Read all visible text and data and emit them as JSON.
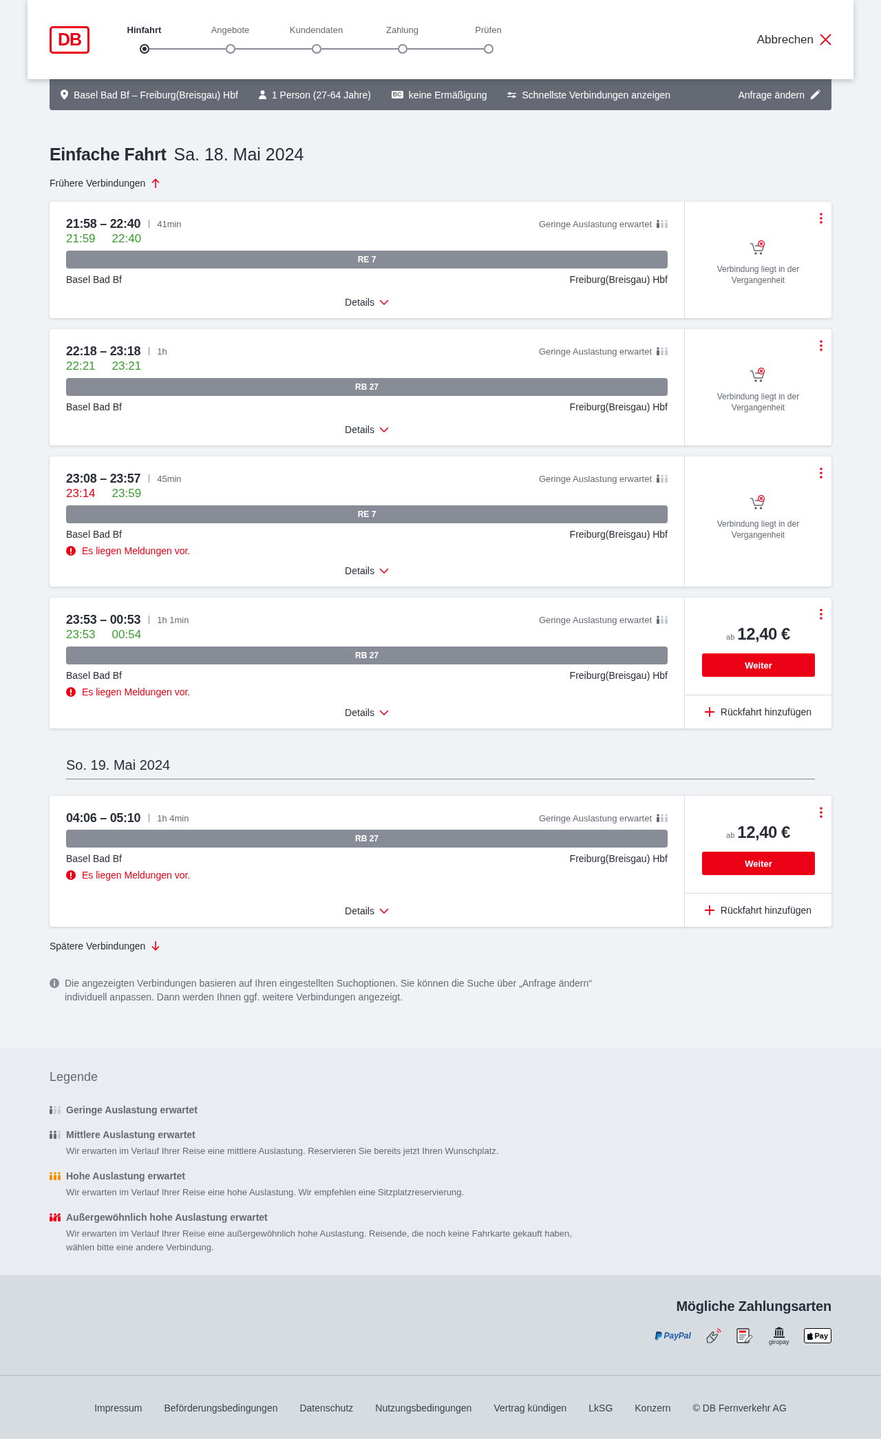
{
  "header": {
    "logo": "DB",
    "steps": [
      {
        "label": "Hinfahrt",
        "selected": true
      },
      {
        "label": "Angebote",
        "selected": false
      },
      {
        "label": "Kundendaten",
        "selected": false
      },
      {
        "label": "Zahlung",
        "selected": false
      },
      {
        "label": "Prüfen",
        "selected": false
      }
    ],
    "cancel": "Abbrechen"
  },
  "search_summary": {
    "route": "Basel Bad Bf – Freiburg(Breisgau) Hbf",
    "travelers": "1 Person (27-64 Jahre)",
    "discount_badge": "BC",
    "discount": "keine Ermäßigung",
    "option": "Schnellste Verbindungen anzeigen",
    "edit": "Anfrage ändern"
  },
  "results": {
    "title": "Einfache Fahrt",
    "date": "Sa. 18. Mai 2024",
    "earlier": "Frühere Verbindungen",
    "days": [
      {
        "connections": [
          {
            "times": "21:58 – 22:40",
            "duration": "41min",
            "realtime": [
              {
                "time": "21:59",
                "delayed": false
              },
              {
                "time": "22:40",
                "delayed": false
              }
            ],
            "occupancy": {
              "kind": "low",
              "label": "Geringe Auslastung erwartet"
            },
            "train": "RE 7",
            "from": "Basel Bad Bf",
            "to": "Freiburg(Breisgau) Hbf",
            "details": "Details",
            "offer": {
              "kind": "past",
              "text": "Verbindung liegt in der Vergangenheit"
            }
          },
          {
            "times": "22:18 – 23:18",
            "duration": "1h",
            "realtime": [
              {
                "time": "22:21",
                "delayed": false
              },
              {
                "time": "23:21",
                "delayed": false
              }
            ],
            "occupancy": {
              "kind": "low",
              "label": "Geringe Auslastung erwartet"
            },
            "train": "RB 27",
            "from": "Basel Bad Bf",
            "to": "Freiburg(Breisgau) Hbf",
            "details": "Details",
            "offer": {
              "kind": "past",
              "text": "Verbindung liegt in der Vergangenheit"
            }
          },
          {
            "times": "23:08 – 23:57",
            "duration": "45min",
            "realtime": [
              {
                "time": "23:14",
                "delayed": true
              },
              {
                "time": "23:59",
                "delayed": false
              }
            ],
            "occupancy": {
              "kind": "low",
              "label": "Geringe Auslastung erwartet"
            },
            "train": "RE 7",
            "from": "Basel Bad Bf",
            "to": "Freiburg(Breisgau) Hbf",
            "message": "Es liegen Meldungen vor.",
            "details": "Details",
            "offer": {
              "kind": "past",
              "text": "Verbindung liegt in der Vergangenheit"
            }
          },
          {
            "times": "23:53 – 00:53",
            "duration": "1h 1min",
            "realtime": [
              {
                "time": "23:53",
                "delayed": false
              },
              {
                "time": "00:54",
                "delayed": false
              }
            ],
            "occupancy": {
              "kind": "low",
              "label": "Geringe Auslastung erwartet"
            },
            "train": "RB 27",
            "from": "Basel Bad Bf",
            "to": "Freiburg(Breisgau) Hbf",
            "message": "Es liegen Meldungen vor.",
            "details": "Details",
            "offer": {
              "kind": "price",
              "prefix": "ab",
              "price": "12,40 €",
              "button": "Weiter",
              "return": "Rückfahrt hinzufügen"
            }
          }
        ]
      },
      {
        "date": "So. 19. Mai 2024",
        "connections": [
          {
            "times": "04:06 – 05:10",
            "duration": "1h 4min",
            "occupancy": {
              "kind": "low",
              "label": "Geringe Auslastung erwartet"
            },
            "train": "RB 27",
            "from": "Basel Bad Bf",
            "to": "Freiburg(Breisgau) Hbf",
            "message": "Es liegen Meldungen vor.",
            "details": "Details",
            "offer": {
              "kind": "price",
              "prefix": "ab",
              "price": "12,40 €",
              "button": "Weiter",
              "return": "Rückfahrt hinzufügen"
            }
          }
        ]
      }
    ],
    "later": "Spätere Verbindungen",
    "note": "Die angezeigten Verbindungen basieren auf Ihren eingestellten Suchoptionen. Sie können die Suche über „Anfrage ändern“ individuell anpassen. Dann werden Ihnen ggf. weitere Verbindungen angezeigt."
  },
  "legend": {
    "title": "Legende",
    "items": [
      {
        "kind": "low",
        "title": "Geringe Auslastung erwartet"
      },
      {
        "kind": "medium",
        "title": "Mittlere Auslastung erwartet",
        "text": "Wir erwarten im Verlauf Ihrer Reise eine mittlere Auslastung. Reservieren Sie bereits jetzt Ihren Wunschplatz."
      },
      {
        "kind": "high",
        "title": "Hohe Auslastung erwartet",
        "text": "Wir erwarten im Verlauf Ihrer Reise eine hohe Auslastung. Wir empfehlen eine Sitzplatzreservierung."
      },
      {
        "kind": "very_high",
        "title": "Außergewöhnlich hohe Auslastung erwartet",
        "text": "Wir erwarten im Verlauf Ihrer Reise eine außergewöhnlich hohe Auslastung. Reisende, die noch keine Fahrkarte gekauft haben, wählen bitte eine andere Verbindung."
      }
    ]
  },
  "payment": {
    "title": "Mögliche Zahlungsarten",
    "methods": [
      {
        "kind": "paypal",
        "label": "PayPal"
      },
      {
        "kind": "contactless"
      },
      {
        "kind": "sepa"
      },
      {
        "kind": "giropay",
        "label": "giropay"
      },
      {
        "kind": "applepay",
        "label": "Pay"
      }
    ]
  },
  "footer": {
    "links": [
      "Impressum",
      "Beförderungsbedingungen",
      "Datenschutz",
      "Nutzungsbedingungen",
      "Vertrag kündigen",
      "LkSG",
      "Konzern"
    ],
    "copyright": "© DB Fernverkehr AG"
  }
}
